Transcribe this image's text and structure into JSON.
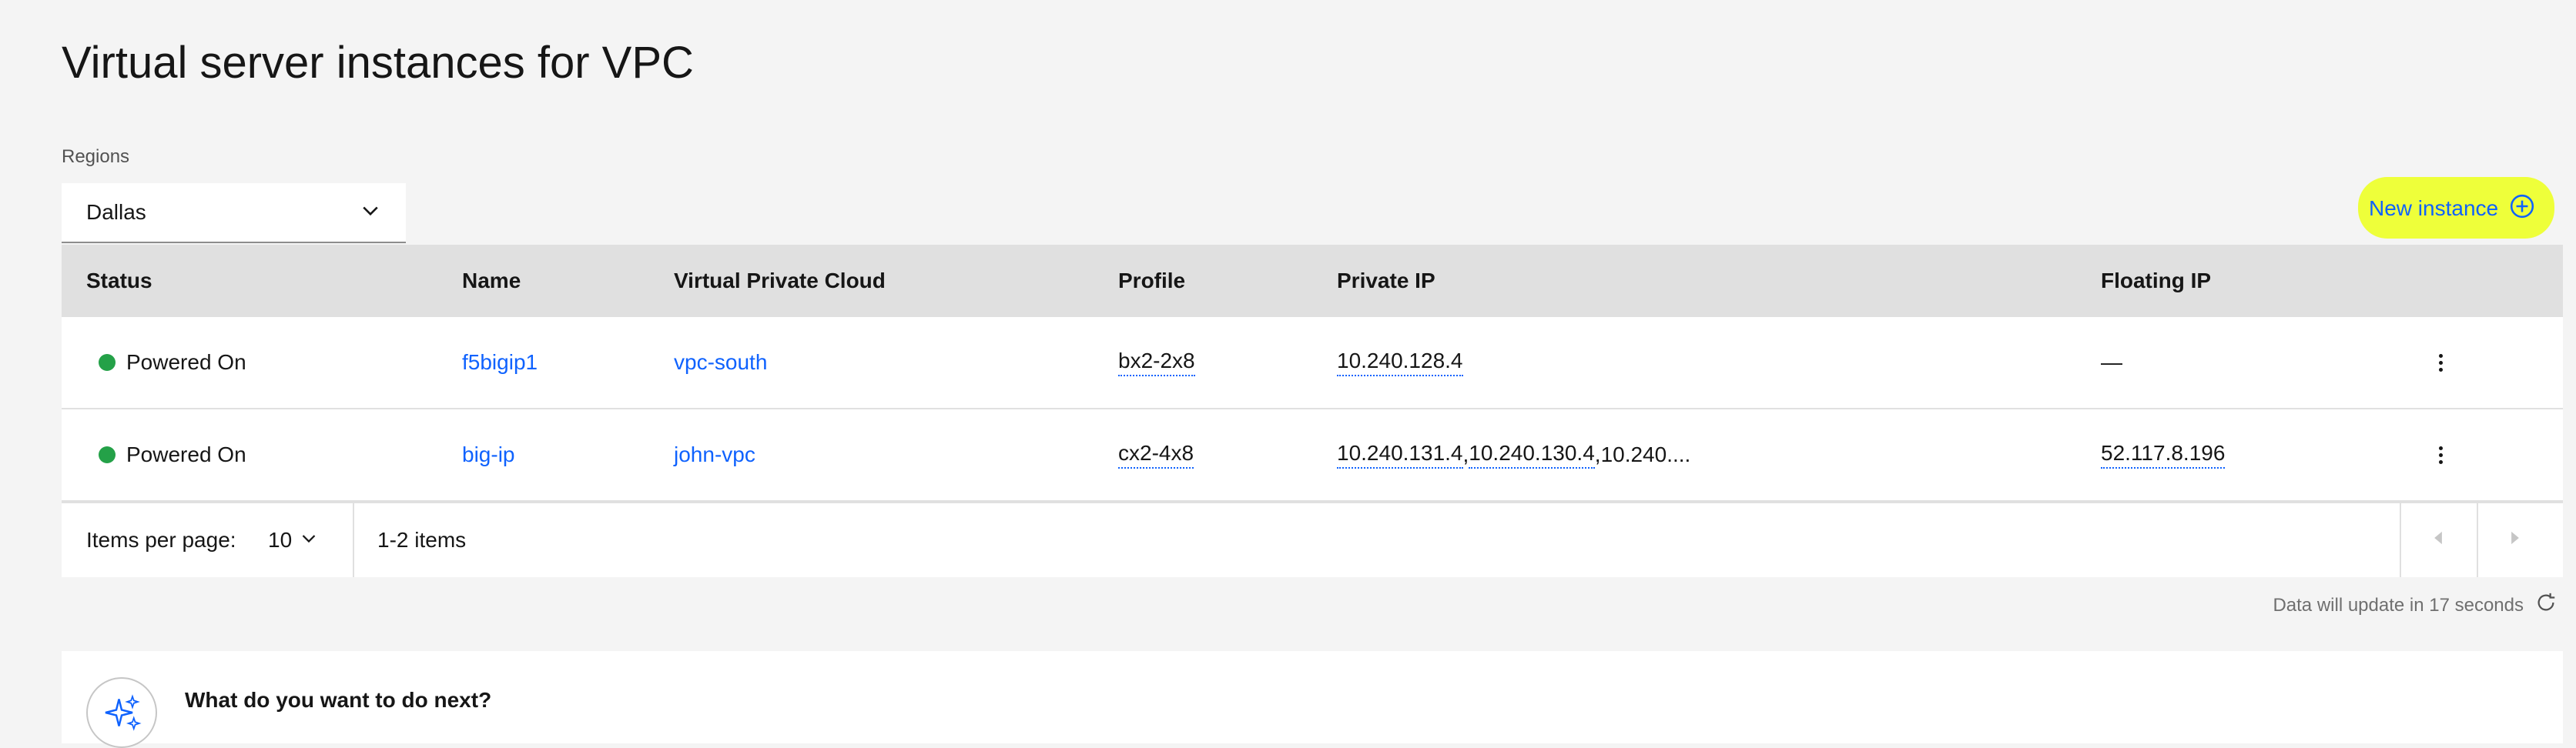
{
  "page": {
    "title": "Virtual server instances for VPC"
  },
  "regions": {
    "label": "Regions",
    "selected": "Dallas"
  },
  "toolbar": {
    "new_instance_label": "New instance"
  },
  "table": {
    "headers": {
      "status": "Status",
      "name": "Name",
      "vpc": "Virtual Private Cloud",
      "profile": "Profile",
      "private_ip": "Private IP",
      "floating_ip": "Floating IP"
    },
    "rows": [
      {
        "status": "Powered On",
        "name": "f5bigip1",
        "vpc": "vpc-south",
        "profile": "bx2-2x8",
        "private_ips": [
          "10.240.128.4"
        ],
        "private_ip_more": "",
        "floating_ip": "—"
      },
      {
        "status": "Powered On",
        "name": "big-ip",
        "vpc": "john-vpc",
        "profile": "cx2-4x8",
        "private_ips": [
          "10.240.131.4",
          "10.240.130.4"
        ],
        "private_ip_more": "10.240....",
        "floating_ip": "52.117.8.196"
      }
    ]
  },
  "pagination": {
    "items_per_page_label": "Items per page:",
    "items_per_page_value": "10",
    "items_range": "1-2 items"
  },
  "update_note": "Data will update in 17 seconds",
  "next_steps": {
    "title": "What do you want to do next?",
    "subtitle": ""
  },
  "colors": {
    "accent": "#0f62fe",
    "status_on": "#24a148",
    "highlight": "#eeff3a"
  },
  "icons": {
    "region_dropdown": "chevron-down-icon",
    "new_instance": "add-circle-icon",
    "row_menu": "overflow-menu-icon",
    "prev_page": "caret-left-icon",
    "next_page": "caret-right-icon",
    "refresh": "refresh-icon",
    "next_steps": "sparkle-icon"
  }
}
